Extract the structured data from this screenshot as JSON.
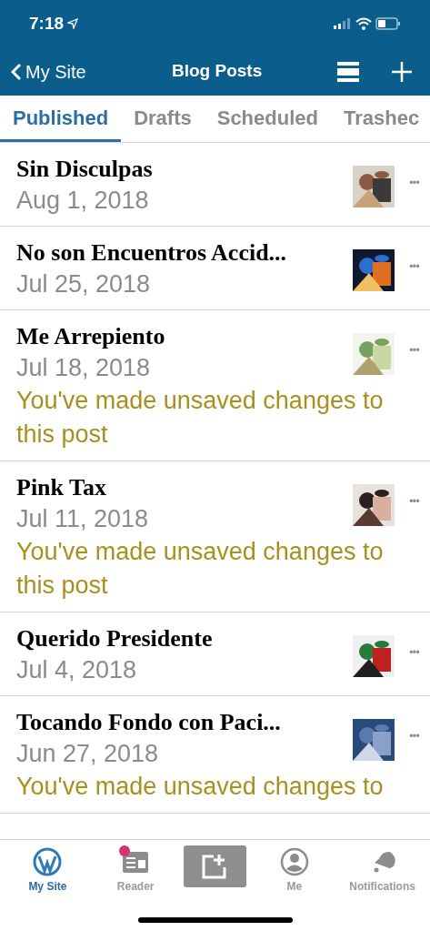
{
  "status_bar": {
    "time": "7:18"
  },
  "nav": {
    "back": "My Site",
    "title": "Blog Posts"
  },
  "tabs": [
    {
      "label": "Published",
      "selected": true
    },
    {
      "label": "Drafts",
      "selected": false
    },
    {
      "label": "Scheduled",
      "selected": false
    },
    {
      "label": "Trashec",
      "selected": false
    }
  ],
  "posts": [
    {
      "title": "Sin Disculpas",
      "date": "Aug 1, 2018",
      "more": "•••"
    },
    {
      "title": "No son Encuentros Accid...",
      "date": "Jul 25, 2018",
      "more": "•••"
    },
    {
      "title": "Me Arrepiento",
      "date": "Jul 18, 2018",
      "note": "You've made unsaved changes to this post",
      "more": "•••"
    },
    {
      "title": "Pink Tax",
      "date": "Jul 11, 2018",
      "note": "You've made unsaved changes to this post",
      "more": "•••"
    },
    {
      "title": "Querido Presidente",
      "date": "Jul 4, 2018",
      "more": "•••"
    },
    {
      "title": "Tocando Fondo con Paci...",
      "date": "Jun 27, 2018",
      "note": "You've made unsaved changes to",
      "more": "•••"
    }
  ],
  "tab_bar": [
    {
      "label": "My Site",
      "selected": true,
      "badge": false
    },
    {
      "label": "Reader",
      "selected": false,
      "badge": true
    },
    {
      "selected": false,
      "badge": false
    },
    {
      "label": "Me",
      "selected": false,
      "badge": false
    },
    {
      "label": "Notifications",
      "selected": false,
      "badge": false
    }
  ]
}
